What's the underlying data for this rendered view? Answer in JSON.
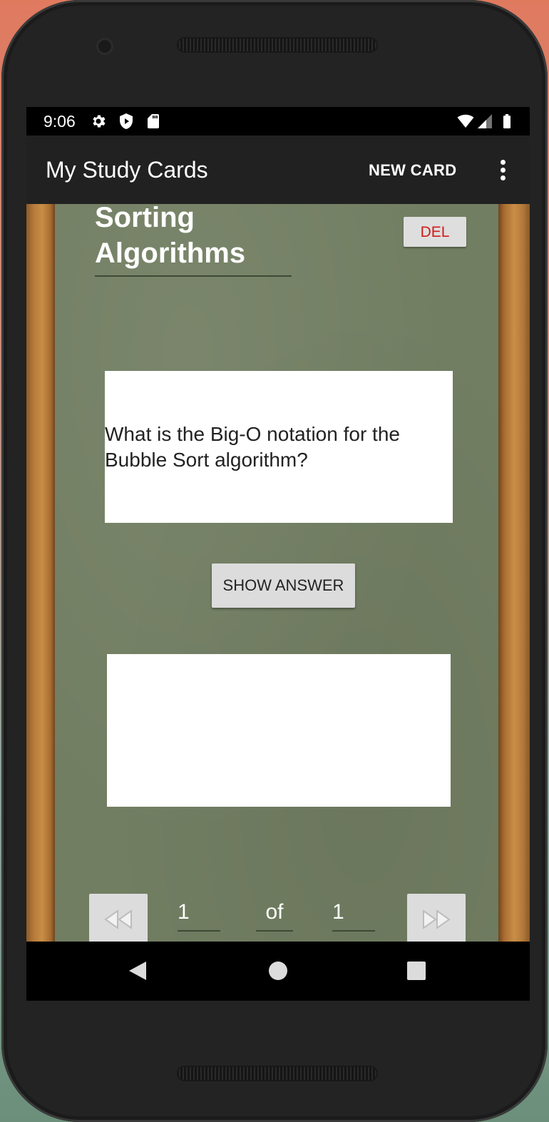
{
  "status": {
    "time": "9:06"
  },
  "appbar": {
    "title": "My Study Cards",
    "new_card_label": "NEW CARD"
  },
  "deck": {
    "title": "Sorting Algorithms",
    "delete_label": "DEL"
  },
  "card": {
    "question": "What is the Big-O notation for the Bubble Sort algorithm?",
    "answer": "",
    "show_answer_label": "SHOW ANSWER"
  },
  "pager": {
    "current": "1",
    "of_label": "of",
    "total": "1"
  },
  "colors": {
    "board": "#727e62",
    "wood": "#b57a3a",
    "delete_text": "#d01b1b"
  }
}
